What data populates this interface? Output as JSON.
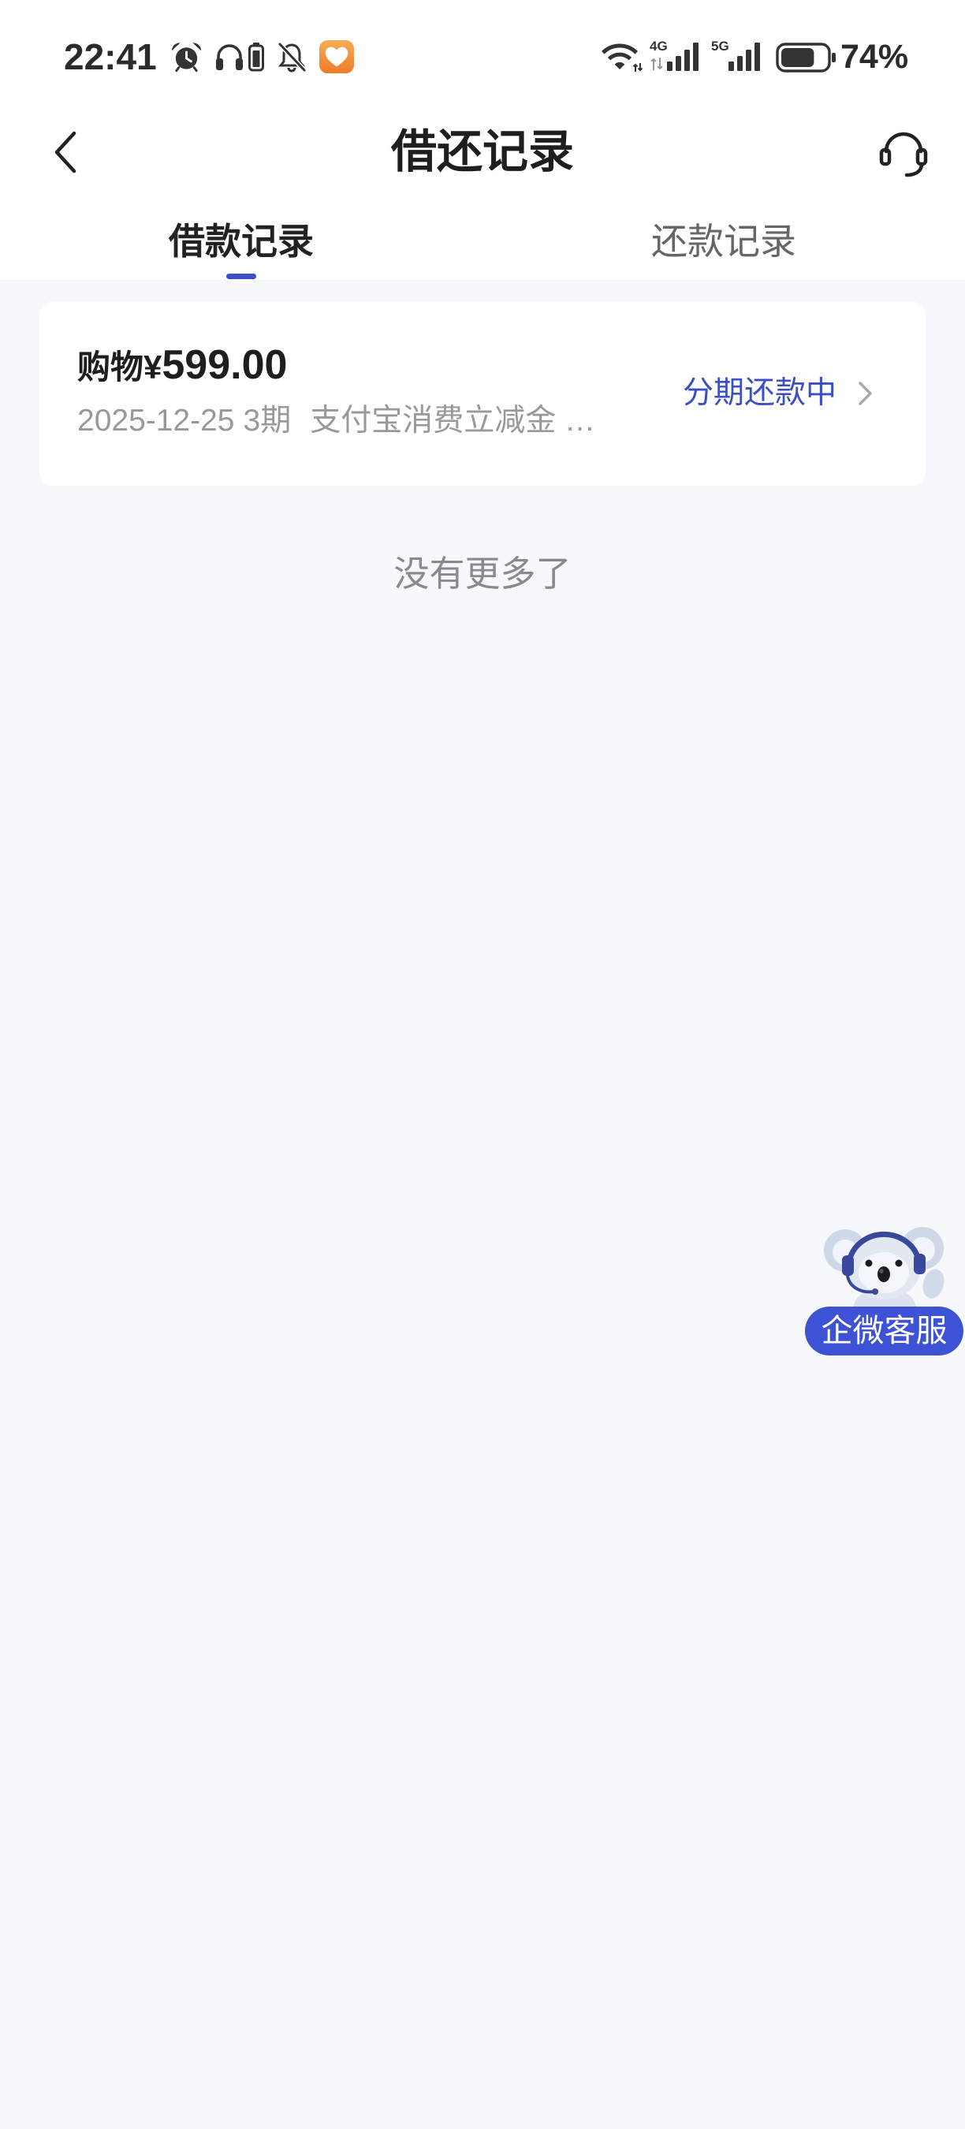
{
  "status_bar": {
    "time": "22:41",
    "icons_left": [
      "alarm-icon",
      "headphones-icon",
      "earbuds-battery-icon",
      "bell-off-icon",
      "heart-app-icon"
    ],
    "wifi_bars": 3,
    "network_4g_label": "4G",
    "network_4g_bars": 4,
    "network_5g_label": "5G",
    "network_5g_bars": 4,
    "battery_percent": "74%"
  },
  "header": {
    "back_icon": "chevron-left-icon",
    "title": "借还记录",
    "service_icon": "headset-icon"
  },
  "tabs": [
    {
      "label": "借款记录",
      "active": true
    },
    {
      "label": "还款记录",
      "active": false
    }
  ],
  "records": [
    {
      "category": "购物",
      "currency": "¥",
      "amount": "599.00",
      "date": "2025-12-25",
      "periods": "3期",
      "note": "支付宝消费立减金 …",
      "status": "分期还款中",
      "chevron_icon": "chevron-right-icon"
    }
  ],
  "list_end_text": "没有更多了",
  "floating_service": {
    "mascot": "koala-mascot-icon",
    "label": "企微客服"
  },
  "colors": {
    "accent": "#3b50c8",
    "status_text": "#3a4fc4",
    "page_background": "#f7f8fc",
    "secondary_text": "#999999",
    "service_pill": "#3d52d5"
  }
}
